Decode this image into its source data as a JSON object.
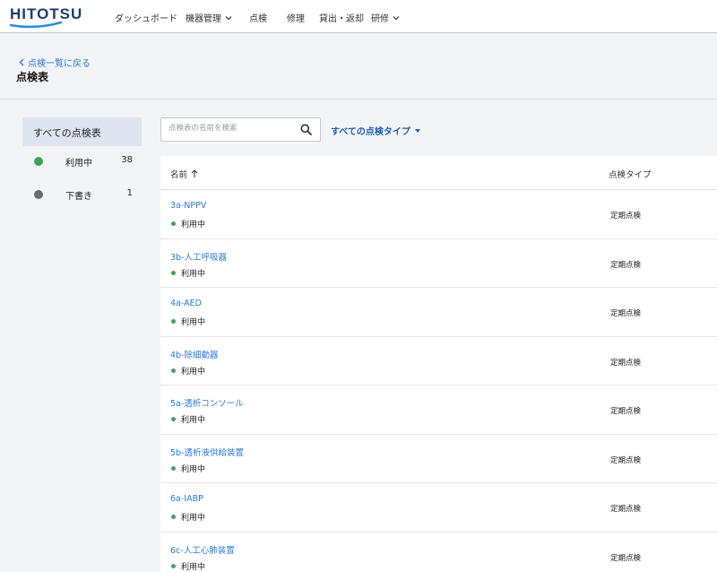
{
  "brand": {
    "name": "HITOTSU",
    "color": "#1a3d6e",
    "swoosh_color": "#2b8fd6"
  },
  "nav": {
    "items": [
      {
        "label": "ダッシュボード",
        "dropdown": false
      },
      {
        "label": "機器管理",
        "dropdown": true
      },
      {
        "label": "点検",
        "dropdown": false
      },
      {
        "label": "修理",
        "dropdown": false
      },
      {
        "label": "貸出・返却",
        "dropdown": false
      },
      {
        "label": "研修",
        "dropdown": true
      }
    ]
  },
  "header": {
    "back_link": "点検一覧に戻る",
    "title": "点検表"
  },
  "sidebar": {
    "all_label": "すべての点検表",
    "items": [
      {
        "label": "利用中",
        "count": "38",
        "color": "#3fa35b"
      },
      {
        "label": "下書き",
        "count": "1",
        "color": "#6b6b6b"
      }
    ]
  },
  "search": {
    "placeholder": "点検表の名前を検索",
    "value": ""
  },
  "filter": {
    "label": "すべての点検タイプ"
  },
  "table": {
    "columns": {
      "name": "名前",
      "type": "点検タイプ"
    },
    "status_color": "#3fa35b",
    "rows": [
      {
        "name": "3a-NPPV",
        "status": "利用中",
        "type": "定期点検"
      },
      {
        "name": "3b-人工呼吸器",
        "status": "利用中",
        "type": "定期点検"
      },
      {
        "name": "4a-AED",
        "status": "利用中",
        "type": "定期点検"
      },
      {
        "name": "4b-除細動器",
        "status": "利用中",
        "type": "定期点検"
      },
      {
        "name": "5a-透析コンソール",
        "status": "利用中",
        "type": "定期点検"
      },
      {
        "name": "5b-透析液供給装置",
        "status": "利用中",
        "type": "定期点検"
      },
      {
        "name": "6a-IABP",
        "status": "利用中",
        "type": "定期点検"
      },
      {
        "name": "6c-人工心肺装置",
        "status": "利用中",
        "type": "定期点検"
      }
    ]
  },
  "accent": "#2b7bd6"
}
